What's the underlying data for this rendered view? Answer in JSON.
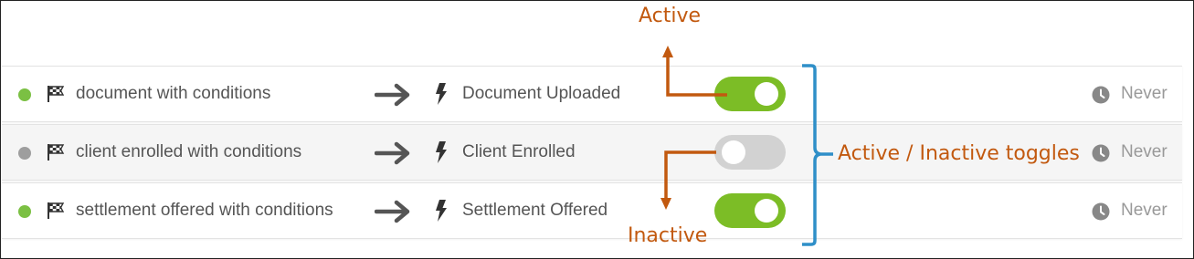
{
  "colors": {
    "active_dot": "#7bc043",
    "inactive_dot": "#9e9e9e",
    "toggle_on": "#7cbd26",
    "toggle_off": "#d2d2d2",
    "annotation_orange": "#c2590f",
    "annotation_blue": "#2f8fc8"
  },
  "rows": [
    {
      "status": "active",
      "name": "document with conditions",
      "trigger": "Document Uploaded",
      "enabled": true,
      "last_run": "Never"
    },
    {
      "status": "inactive",
      "name": "client enrolled with conditions",
      "trigger": "Client Enrolled",
      "enabled": false,
      "last_run": "Never"
    },
    {
      "status": "active",
      "name": "settlement offered with conditions",
      "trigger": "Settlement Offered",
      "enabled": true,
      "last_run": "Never"
    }
  ],
  "annotations": {
    "active": "Active",
    "inactive": "Inactive",
    "toggles": "Active / Inactive toggles"
  }
}
